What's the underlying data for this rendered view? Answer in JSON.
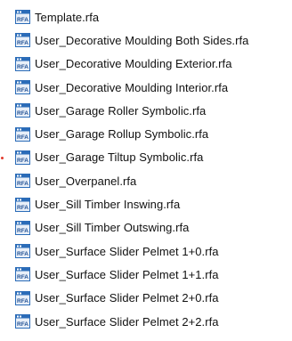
{
  "icon": {
    "name": "rfa-family-file-icon",
    "text": "RFA"
  },
  "files": [
    {
      "label": "Template.rfa"
    },
    {
      "label": "User_Decorative Moulding Both Sides.rfa"
    },
    {
      "label": "User_Decorative Moulding Exterior.rfa"
    },
    {
      "label": "User_Decorative Moulding Interior.rfa"
    },
    {
      "label": "User_Garage Roller Symbolic.rfa"
    },
    {
      "label": "User_Garage Rollup Symbolic.rfa"
    },
    {
      "label": "User_Garage Tiltup Symbolic.rfa"
    },
    {
      "label": "User_Overpanel.rfa"
    },
    {
      "label": "User_Sill Timber Inswing.rfa"
    },
    {
      "label": "User_Sill Timber Outswing.rfa"
    },
    {
      "label": "User_Surface Slider Pelmet 1+0.rfa"
    },
    {
      "label": "User_Surface Slider Pelmet 1+1.rfa"
    },
    {
      "label": "User_Surface Slider Pelmet 2+0.rfa"
    },
    {
      "label": "User_Surface Slider Pelmet 2+2.rfa"
    }
  ],
  "colors": {
    "icon_header": "#2b6cb8",
    "icon_body": "#e8eff8",
    "icon_text": "#1f4f93",
    "marker": "#e23b2e"
  }
}
